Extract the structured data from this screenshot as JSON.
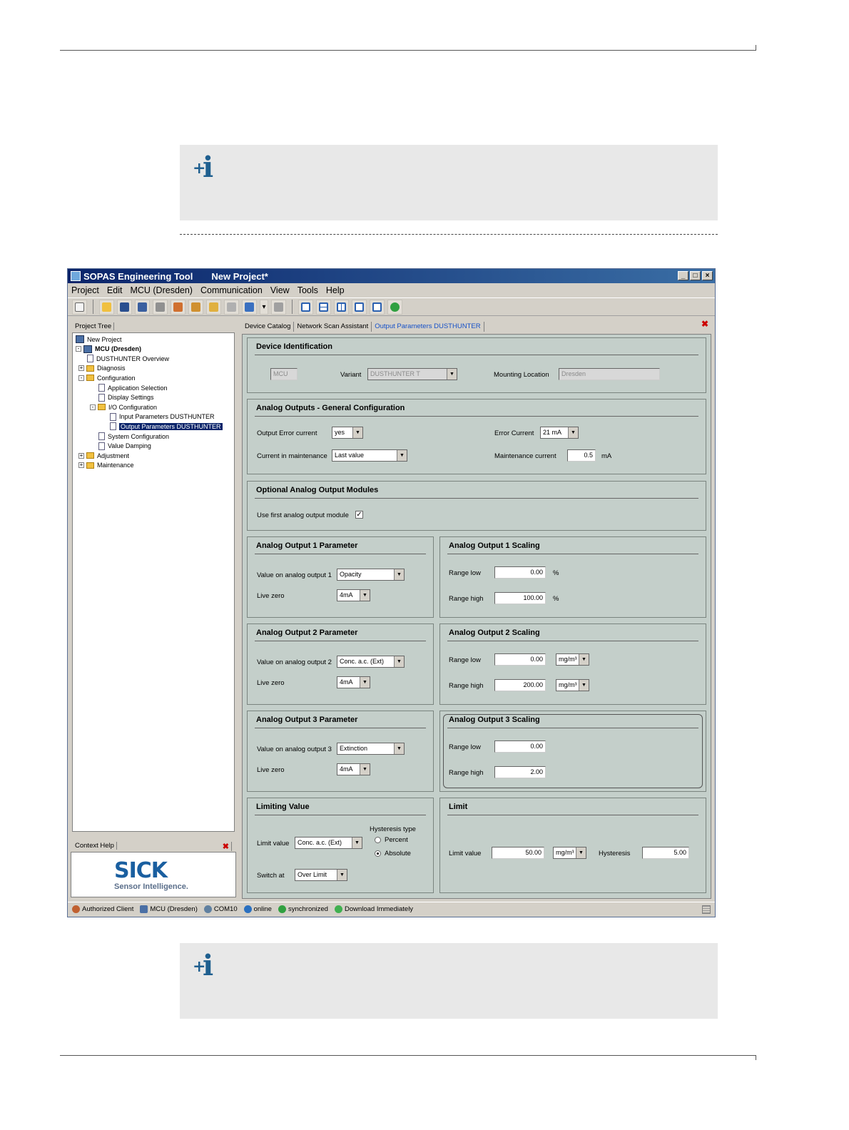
{
  "window": {
    "app_title": "SOPAS Engineering Tool",
    "project_title": "New Project*"
  },
  "menu": [
    "Project",
    "Edit",
    "MCU (Dresden)",
    "Communication",
    "View",
    "Tools",
    "Help"
  ],
  "left": {
    "tree_tab": "Project Tree",
    "tree": [
      {
        "label": "New Project",
        "level": 0,
        "kind": "root"
      },
      {
        "label": "MCU (Dresden)",
        "level": 0,
        "kind": "device",
        "exp": "-"
      },
      {
        "label": "DUSTHUNTER Overview",
        "level": 1,
        "kind": "doc"
      },
      {
        "label": "Diagnosis",
        "level": 1,
        "kind": "folder",
        "exp": "+"
      },
      {
        "label": "Configuration",
        "level": 1,
        "kind": "folder",
        "exp": "-"
      },
      {
        "label": "Application Selection",
        "level": 2,
        "kind": "doc"
      },
      {
        "label": "Display Settings",
        "level": 2,
        "kind": "doc"
      },
      {
        "label": "I/O Configuration",
        "level": 2,
        "kind": "folder",
        "exp": "-"
      },
      {
        "label": "Input Parameters DUSTHUNTER",
        "level": 3,
        "kind": "doc"
      },
      {
        "label": "Output Parameters DUSTHUNTER",
        "level": 3,
        "kind": "doc",
        "selected": true
      },
      {
        "label": "System Configuration",
        "level": 2,
        "kind": "doc"
      },
      {
        "label": "Value Damping",
        "level": 2,
        "kind": "doc"
      },
      {
        "label": "Adjustment",
        "level": 1,
        "kind": "folder",
        "exp": "+"
      },
      {
        "label": "Maintenance",
        "level": 1,
        "kind": "folder",
        "exp": "+"
      }
    ],
    "context_tab": "Context Help",
    "logo_text": "SICK",
    "logo_sub": "Sensor Intelligence."
  },
  "tabs": [
    "Device Catalog",
    "Network Scan Assistant",
    "Output Parameters DUSTHUNTER"
  ],
  "device_id": {
    "title": "Device Identification",
    "device_value": "MCU",
    "variant_label": "Variant",
    "variant_value": "DUSTHUNTER T",
    "location_label": "Mounting Location",
    "location_value": "Dresden"
  },
  "general": {
    "title": "Analog Outputs - General Configuration",
    "out_err_label": "Output Error current",
    "out_err_value": "yes",
    "err_cur_label": "Error Current",
    "err_cur_value": "21 mA",
    "maint_label": "Current in maintenance",
    "maint_value": "Last value",
    "maint_cur_label": "Maintenance current",
    "maint_cur_value": "0.5",
    "maint_cur_unit": "mA"
  },
  "optional": {
    "title": "Optional Analog Output Modules",
    "use_first_label": "Use first analog output module",
    "use_first_checked": "✓"
  },
  "ao1": {
    "param_title": "Analog Output 1 Parameter",
    "value_label": "Value on analog output 1",
    "value": "Opacity",
    "livezero_label": "Live zero",
    "livezero": "4mA",
    "scal_title": "Analog Output 1 Scaling",
    "low_label": "Range low",
    "low": "0.00",
    "low_unit": "%",
    "high_label": "Range high",
    "high": "100.00",
    "high_unit": "%"
  },
  "ao2": {
    "param_title": "Analog Output 2 Parameter",
    "value_label": "Value on analog output 2",
    "value": "Conc. a.c. (Ext)",
    "livezero_label": "Live zero",
    "livezero": "4mA",
    "scal_title": "Analog Output 2 Scaling",
    "low_label": "Range low",
    "low": "0.00",
    "low_unit": "mg/m³",
    "high_label": "Range high",
    "high": "200.00",
    "high_unit": "mg/m³"
  },
  "ao3": {
    "param_title": "Analog Output 3 Parameter",
    "value_label": "Value on analog output 3",
    "value": "Extinction",
    "livezero_label": "Live zero",
    "livezero": "4mA",
    "scal_title": "Analog Output 3 Scaling",
    "low_label": "Range low",
    "low": "0.00",
    "high_label": "Range high",
    "high": "2.00"
  },
  "limiting": {
    "title": "Limiting Value",
    "limit_label": "Limit value",
    "limit_value": "Conc. a.c. (Ext)",
    "hyst_type_label": "Hysteresis type",
    "percent_label": "Percent",
    "absolute_label": "Absolute",
    "switch_label": "Switch at",
    "switch_value": "Over Limit"
  },
  "limit": {
    "title": "Limit",
    "limit_label": "Limit value",
    "limit_value": "50.00",
    "limit_unit": "mg/m³",
    "hyst_label": "Hysteresis",
    "hyst_value": "5.00"
  },
  "status": [
    "Authorized Client",
    "MCU (Dresden)",
    "COM10",
    "online",
    "synchronized",
    "Download Immediately"
  ]
}
